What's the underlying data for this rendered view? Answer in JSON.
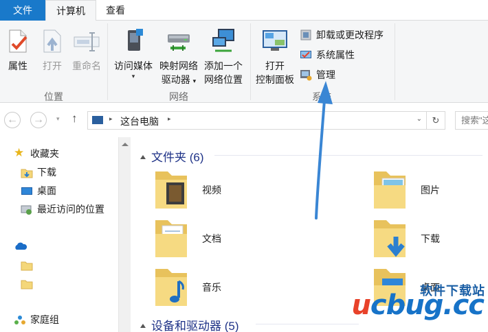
{
  "tabs": {
    "file": "文件",
    "computer": "计算机",
    "view": "查看"
  },
  "ribbon": {
    "location_group": {
      "label": "位置",
      "properties": "属性",
      "open": "打开",
      "rename": "重命名"
    },
    "network_group": {
      "label": "网络",
      "media_line1": "访问媒体",
      "map_line1": "映射网络",
      "map_line2": "驱动器",
      "add_line1": "添加一个",
      "add_line2": "网络位置"
    },
    "system_group": {
      "label": "系统",
      "cp_line1": "打开",
      "cp_line2": "控制面板",
      "uninstall": "卸载或更改程序",
      "sys_props": "系统属性",
      "manage": "管理"
    }
  },
  "address": {
    "path": "这台电脑",
    "search_placeholder": "搜索\"这台电脑\""
  },
  "nav": {
    "favorites": "收藏夹",
    "downloads": "下载",
    "desktop": "桌面",
    "recent": "最近访问的位置",
    "homegroup": "家庭组"
  },
  "content": {
    "folders_header": "文件夹 (6)",
    "devices_header": "设备和驱动器 (5)",
    "folders": [
      {
        "name": "视频"
      },
      {
        "name": "图片"
      },
      {
        "name": "文档"
      },
      {
        "name": "下载"
      },
      {
        "name": "音乐"
      },
      {
        "name": "桌面"
      }
    ]
  },
  "watermark": {
    "cn": "软件下载站",
    "en_e": "u",
    "en_rest": "cbug.cc"
  },
  "colors": {
    "accent": "#1979ca",
    "folder": "#f4d77a",
    "header_text": "#1e3287",
    "arrow": "#3a86d4"
  }
}
